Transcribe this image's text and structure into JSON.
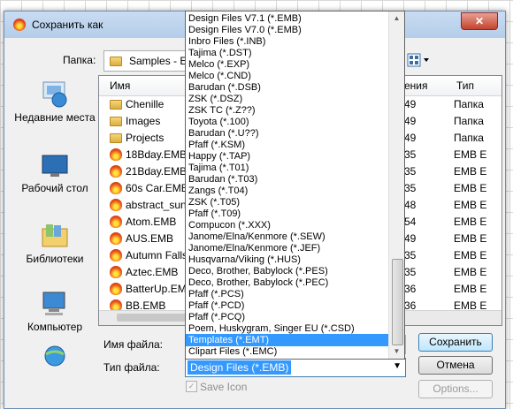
{
  "window": {
    "title": "Сохранить как",
    "close": "✕"
  },
  "folder": {
    "label": "Папка:",
    "value": "Samples - Emb"
  },
  "places": [
    {
      "label": "Недавние места",
      "icon": "recent-places-icon"
    },
    {
      "label": "Рабочий стол",
      "icon": "desktop-icon"
    },
    {
      "label": "Библиотеки",
      "icon": "libraries-icon"
    },
    {
      "label": "Компьютер",
      "icon": "computer-icon"
    },
    {
      "label": "",
      "icon": "network-icon"
    }
  ],
  "columns": {
    "name": "Имя",
    "modified": "ения",
    "type": "Тип"
  },
  "files": [
    {
      "name": "Chenille",
      "time": "49",
      "type": "Папка",
      "icon": "folder-icon"
    },
    {
      "name": "Images",
      "time": "49",
      "type": "Папка",
      "icon": "folder-icon"
    },
    {
      "name": "Projects",
      "time": "49",
      "type": "Папка",
      "icon": "folder-icon"
    },
    {
      "name": "18Bday.EMB",
      "time": "35",
      "type": "EMB E",
      "icon": "emb-file-icon"
    },
    {
      "name": "21Bday.EMB",
      "time": "35",
      "type": "EMB E",
      "icon": "emb-file-icon"
    },
    {
      "name": "60s Car.EMB",
      "time": "35",
      "type": "EMB E",
      "icon": "emb-file-icon"
    },
    {
      "name": "abstract_sun.",
      "time": "48",
      "type": "EMB E",
      "icon": "emb-file-icon"
    },
    {
      "name": "Atom.EMB",
      "time": "54",
      "type": "EMB E",
      "icon": "emb-file-icon"
    },
    {
      "name": "AUS.EMB",
      "time": "49",
      "type": "EMB E",
      "icon": "emb-file-icon"
    },
    {
      "name": "Autumn Falls",
      "time": "35",
      "type": "EMB E",
      "icon": "emb-file-icon"
    },
    {
      "name": "Aztec.EMB",
      "time": "35",
      "type": "EMB E",
      "icon": "emb-file-icon"
    },
    {
      "name": "BatterUp.EMB",
      "time": "36",
      "type": "EMB E",
      "icon": "emb-file-icon"
    },
    {
      "name": "BB.EMB",
      "time": "36",
      "type": "EMB E",
      "icon": "emb-file-icon"
    }
  ],
  "filename": {
    "label": "Имя файла:",
    "value": ""
  },
  "filetype": {
    "label": "Тип файла:",
    "value": "Design Files (*.EMB)"
  },
  "buttons": {
    "save": "Сохранить",
    "cancel": "Отмена",
    "options": "Options..."
  },
  "save_icon": {
    "label": "Save Icon",
    "checked": true
  },
  "filetype_options": [
    "Design Files V7.1 (*.EMB)",
    "Design Files V7.0 (*.EMB)",
    "Inbro Files (*.INB)",
    "Tajima (*.DST)",
    "Melco (*.EXP)",
    "Melco (*.CND)",
    "Barudan (*.DSB)",
    "ZSK (*.DSZ)",
    "ZSK TC (*.Z??)",
    "Toyota (*.100)",
    "Barudan (*.U??)",
    "Pfaff (*.KSM)",
    "Happy (*.TAP)",
    "Tajima (*.T01)",
    "Barudan (*.T03)",
    "Zangs (*.T04)",
    "ZSK (*.T05)",
    "Pfaff (*.T09)",
    "Compucon (*.XXX)",
    "Janome/Elna/Kenmore (*.SEW)",
    "Janome/Elna/Kenmore (*.JEF)",
    "Husqvarna/Viking (*.HUS)",
    "Deco, Brother, Babylock (*.PES)",
    "Deco, Brother, Babylock (*.PEC)",
    "Pfaff (*.PCS)",
    "Pfaff (*.PCD)",
    "Pfaff (*.PCQ)",
    "Poem, Huskygram, Singer EU (*.CSD)",
    "Templates (*.EMT)",
    "Clipart Files (*.EMC)"
  ],
  "selected_option_index": 28,
  "colors": {
    "selection": "#3399ff",
    "title_gradient": "#c9dcf2"
  }
}
